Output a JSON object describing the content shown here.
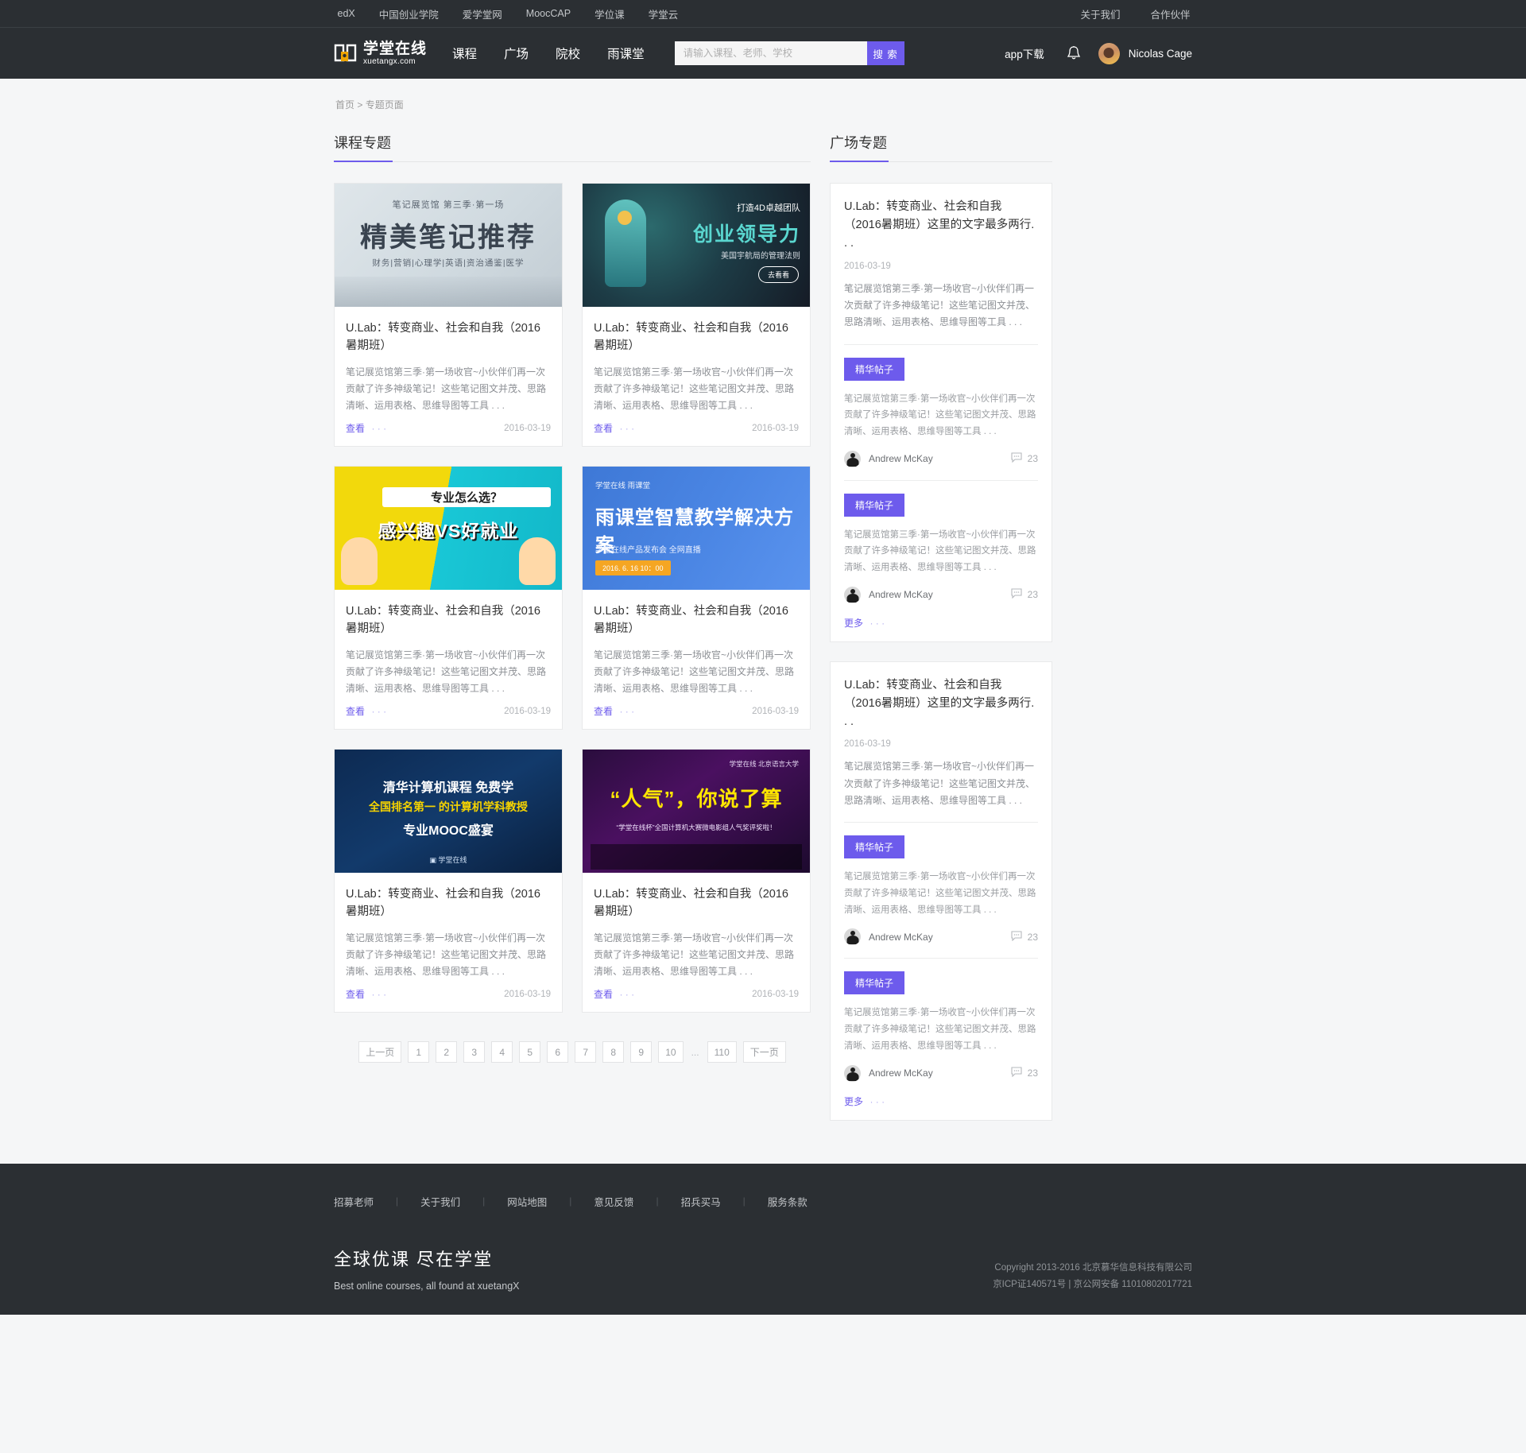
{
  "topbar": {
    "left_links": [
      "edX",
      "中国创业学院",
      "爱学堂网",
      "MoocCAP",
      "学位课",
      "学堂云"
    ],
    "right_links": [
      "关于我们",
      "合作伙伴"
    ]
  },
  "header": {
    "logo_cn": "学堂在线",
    "logo_en": "xuetangx.com",
    "nav": [
      "课程",
      "广场",
      "院校",
      "雨课堂"
    ],
    "search_placeholder": "请输入课程、老师、学校",
    "search_value": "",
    "search_button": "搜 索",
    "app_download": "app下载",
    "bell_icon": "bell-icon",
    "username": "Nicolas Cage",
    "accent_color": "#6d5bec",
    "bar_color": "#2b2f33"
  },
  "breadcrumb": {
    "home": "首页",
    "sep": ">",
    "current": "专题页面"
  },
  "left_section": {
    "title": "课程专题",
    "cards": [
      {
        "thumb_style": "t1",
        "thumb_kicker": "笔记展览馆 第三季·第一场",
        "thumb_main": "精美笔记推荐",
        "thumb_sub": "财务|营销|心理学|英语|资治通鉴|医学",
        "title": "U.Lab：转变商业、社会和自我（2016暑期班）",
        "desc": "笔记展览馆第三季·第一场收官~小伙伴们再一次贡献了许多神级笔记！这些笔记图文并茂、思路清晰、运用表格、思维导图等工具 . . .",
        "more": "查看",
        "more_dots": "· · ·",
        "date": "2016-03-19"
      },
      {
        "thumb_style": "t2",
        "thumb_kicker": "打造4D卓越团队",
        "thumb_main": "创业领导力",
        "thumb_sub": "美国宇航局的管理法则",
        "thumb_btn": "去看看",
        "title": "U.Lab：转变商业、社会和自我（2016暑期班）",
        "desc": "笔记展览馆第三季·第一场收官~小伙伴们再一次贡献了许多神级笔记！这些笔记图文并茂、思路清晰、运用表格、思维导图等工具 . . .",
        "more": "查看",
        "more_dots": "· · ·",
        "date": "2016-03-19"
      },
      {
        "thumb_style": "t3",
        "thumb_kicker": "专业怎么选？",
        "thumb_main": "感兴趣VS好就业",
        "thumb_sub": "",
        "title": "U.Lab：转变商业、社会和自我（2016暑期班）",
        "desc": "笔记展览馆第三季·第一场收官~小伙伴们再一次贡献了许多神级笔记！这些笔记图文并茂、思路清晰、运用表格、思维导图等工具 . . .",
        "more": "查看",
        "more_dots": "· · ·",
        "date": "2016-03-19"
      },
      {
        "thumb_style": "t4",
        "thumb_kicker": "学堂在线  雨课堂",
        "thumb_main": "雨课堂智慧教学解决方案",
        "thumb_sub": "学堂在线产品发布会 全网直播",
        "thumb_btn": "2016. 6. 16  10：00",
        "title": "U.Lab：转变商业、社会和自我（2016暑期班）",
        "desc": "笔记展览馆第三季·第一场收官~小伙伴们再一次贡献了许多神级笔记！这些笔记图文并茂、思路清晰、运用表格、思维导图等工具 . . .",
        "more": "查看",
        "more_dots": "· · ·",
        "date": "2016-03-19"
      },
      {
        "thumb_style": "t5",
        "thumb_kicker": "清华计算机课程 免费学",
        "thumb_main": "全国排名第一 的计算机学科教授",
        "thumb_sub": "专业MOOC盛宴",
        "title": "U.Lab：转变商业、社会和自我（2016暑期班）",
        "desc": "笔记展览馆第三季·第一场收官~小伙伴们再一次贡献了许多神级笔记！这些笔记图文并茂、思路清晰、运用表格、思维导图等工具 . . .",
        "more": "查看",
        "more_dots": "· · ·",
        "date": "2016-03-19"
      },
      {
        "thumb_style": "t6",
        "thumb_kicker": "学堂在线   北京语言大学",
        "thumb_main": "“人气”，你说了算",
        "thumb_sub": "“学堂在线杯”全国计算机大赛微电影组人气奖评奖啦！",
        "title": "U.Lab：转变商业、社会和自我（2016暑期班）",
        "desc": "笔记展览馆第三季·第一场收官~小伙伴们再一次贡献了许多神级笔记！这些笔记图文并茂、思路清晰、运用表格、思维导图等工具 . . .",
        "more": "查看",
        "more_dots": "· · ·",
        "date": "2016-03-19"
      }
    ]
  },
  "pagination": {
    "prev": "上一页",
    "pages": [
      "1",
      "2",
      "3",
      "4",
      "5",
      "6",
      "7",
      "8",
      "9",
      "10"
    ],
    "ellipsis": "...",
    "last": "110",
    "next": "下一页"
  },
  "right_section": {
    "title": "广场专题",
    "panels": [
      {
        "title": "U.Lab：转变商业、社会和自我（2016暑期班）这里的文字最多两行. . .",
        "date": "2016-03-19",
        "desc": "笔记展览馆第三季·第一场收官~小伙伴们再一次贡献了许多神级笔记！这些笔记图文并茂、思路清晰、运用表格、思维导图等工具 . . .",
        "posts": [
          {
            "badge": "精华帖子",
            "text": "笔记展览馆第三季·第一场收官~小伙伴们再一次贡献了许多神级笔记！这些笔记图文并茂、思路清晰、运用表格、思维导图等工具 . . .",
            "author": "Andrew McKay",
            "comment_icon": "comment-icon",
            "comments": "23"
          },
          {
            "badge": "精华帖子",
            "text": "笔记展览馆第三季·第一场收官~小伙伴们再一次贡献了许多神级笔记！这些笔记图文并茂、思路清晰、运用表格、思维导图等工具 . . .",
            "author": "Andrew McKay",
            "comment_icon": "comment-icon",
            "comments": "23"
          }
        ],
        "more": "更多",
        "more_dots": "· · ·"
      },
      {
        "title": "U.Lab：转变商业、社会和自我（2016暑期班）这里的文字最多两行. . .",
        "date": "2016-03-19",
        "desc": "笔记展览馆第三季·第一场收官~小伙伴们再一次贡献了许多神级笔记！这些笔记图文并茂、思路清晰、运用表格、思维导图等工具 . . .",
        "posts": [
          {
            "badge": "精华帖子",
            "text": "笔记展览馆第三季·第一场收官~小伙伴们再一次贡献了许多神级笔记！这些笔记图文并茂、思路清晰、运用表格、思维导图等工具 . . .",
            "author": "Andrew McKay",
            "comment_icon": "comment-icon",
            "comments": "23"
          },
          {
            "badge": "精华帖子",
            "text": "笔记展览馆第三季·第一场收官~小伙伴们再一次贡献了许多神级笔记！这些笔记图文并茂、思路清晰、运用表格、思维导图等工具 . . .",
            "author": "Andrew McKay",
            "comment_icon": "comment-icon",
            "comments": "23"
          }
        ],
        "more": "更多",
        "more_dots": "· · ·"
      }
    ]
  },
  "footer": {
    "links": [
      "招募老师",
      "关于我们",
      "网站地图",
      "意见反馈",
      "招兵买马",
      "服务条款"
    ],
    "slogan_cn": "全球优课  尽在学堂",
    "slogan_en": "Best online courses, all found at xuetangX",
    "copyright1": "Copyright 2013-2016 北京慕华信息科技有限公司",
    "copyright2": "京ICP证140571号 | 京公网安备 11010802017721"
  }
}
